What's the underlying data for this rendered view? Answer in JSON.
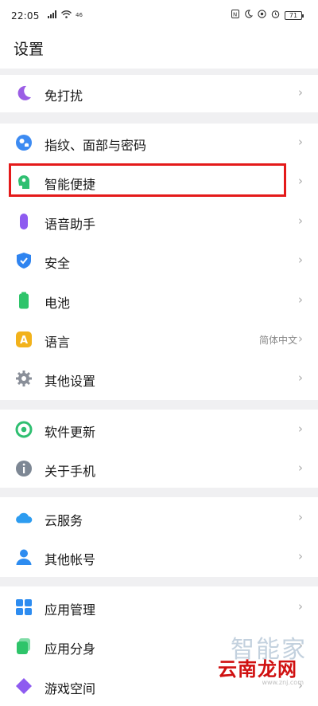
{
  "status_bar": {
    "time": "22:05",
    "battery": "71",
    "left_icons": [
      "signal-icon",
      "wifi-icon",
      "data-icon"
    ],
    "right_icons": [
      "nfc-icon",
      "moon-icon",
      "location-icon",
      "alarm-icon"
    ]
  },
  "page": {
    "title": "设置"
  },
  "items": [
    {
      "label": "免打扰",
      "icon": "moon-icon",
      "color": "#9b5de5"
    },
    {
      "label": "指纹、面部与密码",
      "icon": "fingerprint-icon",
      "color": "#3d8bf2"
    },
    {
      "label": "智能便捷",
      "icon": "smart-assistant-icon",
      "color": "#2fbf71"
    },
    {
      "label": "语音助手",
      "icon": "microphone-icon",
      "color": "#8e5bf0"
    },
    {
      "label": "安全",
      "icon": "shield-icon",
      "color": "#2f84f0"
    },
    {
      "label": "电池",
      "icon": "battery-icon",
      "color": "#2ec46a"
    },
    {
      "label": "语言",
      "value": "简体中文",
      "icon": "language-icon",
      "color": "#f2b21b"
    },
    {
      "label": "其他设置",
      "icon": "gear-icon",
      "color": "#8a8f99"
    },
    {
      "label": "软件更新",
      "icon": "update-icon",
      "color": "#2fbf71"
    },
    {
      "label": "关于手机",
      "icon": "info-icon",
      "color": "#7d8794"
    },
    {
      "label": "云服务",
      "icon": "cloud-icon",
      "color": "#2d9cf0"
    },
    {
      "label": "其他帐号",
      "icon": "person-icon",
      "color": "#2d8cf0"
    },
    {
      "label": "应用管理",
      "icon": "app-grid-icon",
      "color": "#2d8cf0"
    },
    {
      "label": "应用分身",
      "icon": "clone-app-icon",
      "color": "#2ec46a"
    },
    {
      "label": "游戏空间",
      "icon": "game-icon",
      "color": "#8e5bf0"
    }
  ],
  "chevron": "›",
  "watermark": {
    "top": "智能家",
    "bottom": "云南龙网",
    "url": "www.znj.com"
  },
  "highlight_color": "#e41a1a"
}
